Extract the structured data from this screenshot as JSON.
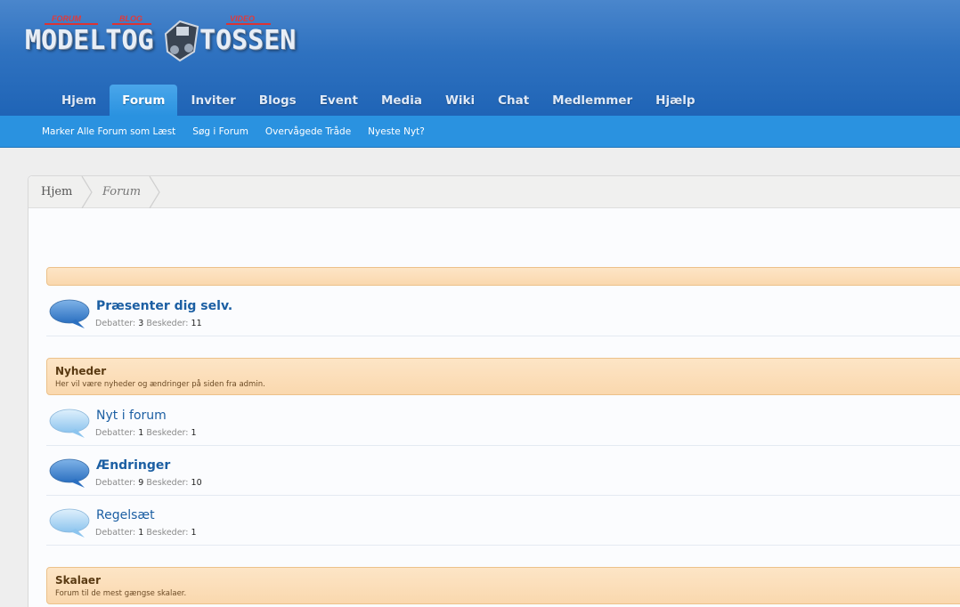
{
  "brand": {
    "logo_left": "MODELTOG",
    "logo_right": "TOSSEN",
    "mini_labels": [
      "FORUM",
      "BLOG",
      "VIDEO"
    ]
  },
  "nav": {
    "tabs": [
      {
        "label": "Hjem"
      },
      {
        "label": "Forum"
      },
      {
        "label": "Inviter"
      },
      {
        "label": "Blogs"
      },
      {
        "label": "Event"
      },
      {
        "label": "Media"
      },
      {
        "label": "Wiki"
      },
      {
        "label": "Chat"
      },
      {
        "label": "Medlemmer"
      },
      {
        "label": "Hjælp"
      }
    ],
    "active_tab": "Forum"
  },
  "subnav": {
    "items": [
      {
        "label": "Marker Alle Forum som Læst"
      },
      {
        "label": "Søg i Forum"
      },
      {
        "label": "Overvågede Tråde"
      },
      {
        "label": "Nyeste Nyt?"
      }
    ]
  },
  "breadcrumb": {
    "items": [
      {
        "label": "Hjem"
      },
      {
        "label": "Forum"
      }
    ]
  },
  "categories": [
    {
      "title": "",
      "description": ""
    },
    {
      "title": "Nyheder",
      "description": "Her vil være nyheder og ændringer på siden fra admin."
    },
    {
      "title": "Skalaer",
      "description": "Forum til de mest gængse skalaer."
    }
  ],
  "forums": [
    {
      "title": "Præsenter dig selv.",
      "threads_label": "Debatter:",
      "threads": "3",
      "messages_label": "Beskeder:",
      "messages": "11",
      "unread": true
    },
    {
      "title": "Nyt i forum",
      "threads_label": "Debatter:",
      "threads": "1",
      "messages_label": "Beskeder:",
      "messages": "1",
      "unread": false
    },
    {
      "title": "Ændringer",
      "threads_label": "Debatter:",
      "threads": "9",
      "messages_label": "Beskeder:",
      "messages": "10",
      "unread": true
    },
    {
      "title": "Regelsæt",
      "threads_label": "Debatter:",
      "threads": "1",
      "messages_label": "Beskeder:",
      "messages": "1",
      "unread": false
    }
  ],
  "colors": {
    "header_blue": "#2f72c0",
    "subnav_blue": "#2a92e0",
    "category_bg": "#fad8ae",
    "link_blue": "#1c5fa3"
  }
}
